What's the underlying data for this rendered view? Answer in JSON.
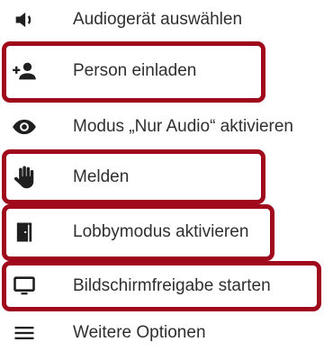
{
  "menu": {
    "items": [
      {
        "label": "Audiogerät auswählen",
        "icon": "speaker-icon"
      },
      {
        "label": "Person einladen",
        "icon": "add-person-icon"
      },
      {
        "label": "Modus „Nur Audio“ aktivieren",
        "icon": "eye-icon"
      },
      {
        "label": "Melden",
        "icon": "hand-icon"
      },
      {
        "label": "Lobbymodus aktivieren",
        "icon": "door-icon"
      },
      {
        "label": "Bildschirmfreigabe starten",
        "icon": "monitor-icon"
      },
      {
        "label": "Weitere Optionen",
        "icon": "menu-icon"
      }
    ]
  },
  "colors": {
    "highlight": "#a0081b",
    "text": "#2f2f2f",
    "icon": "#1f1f1f"
  }
}
